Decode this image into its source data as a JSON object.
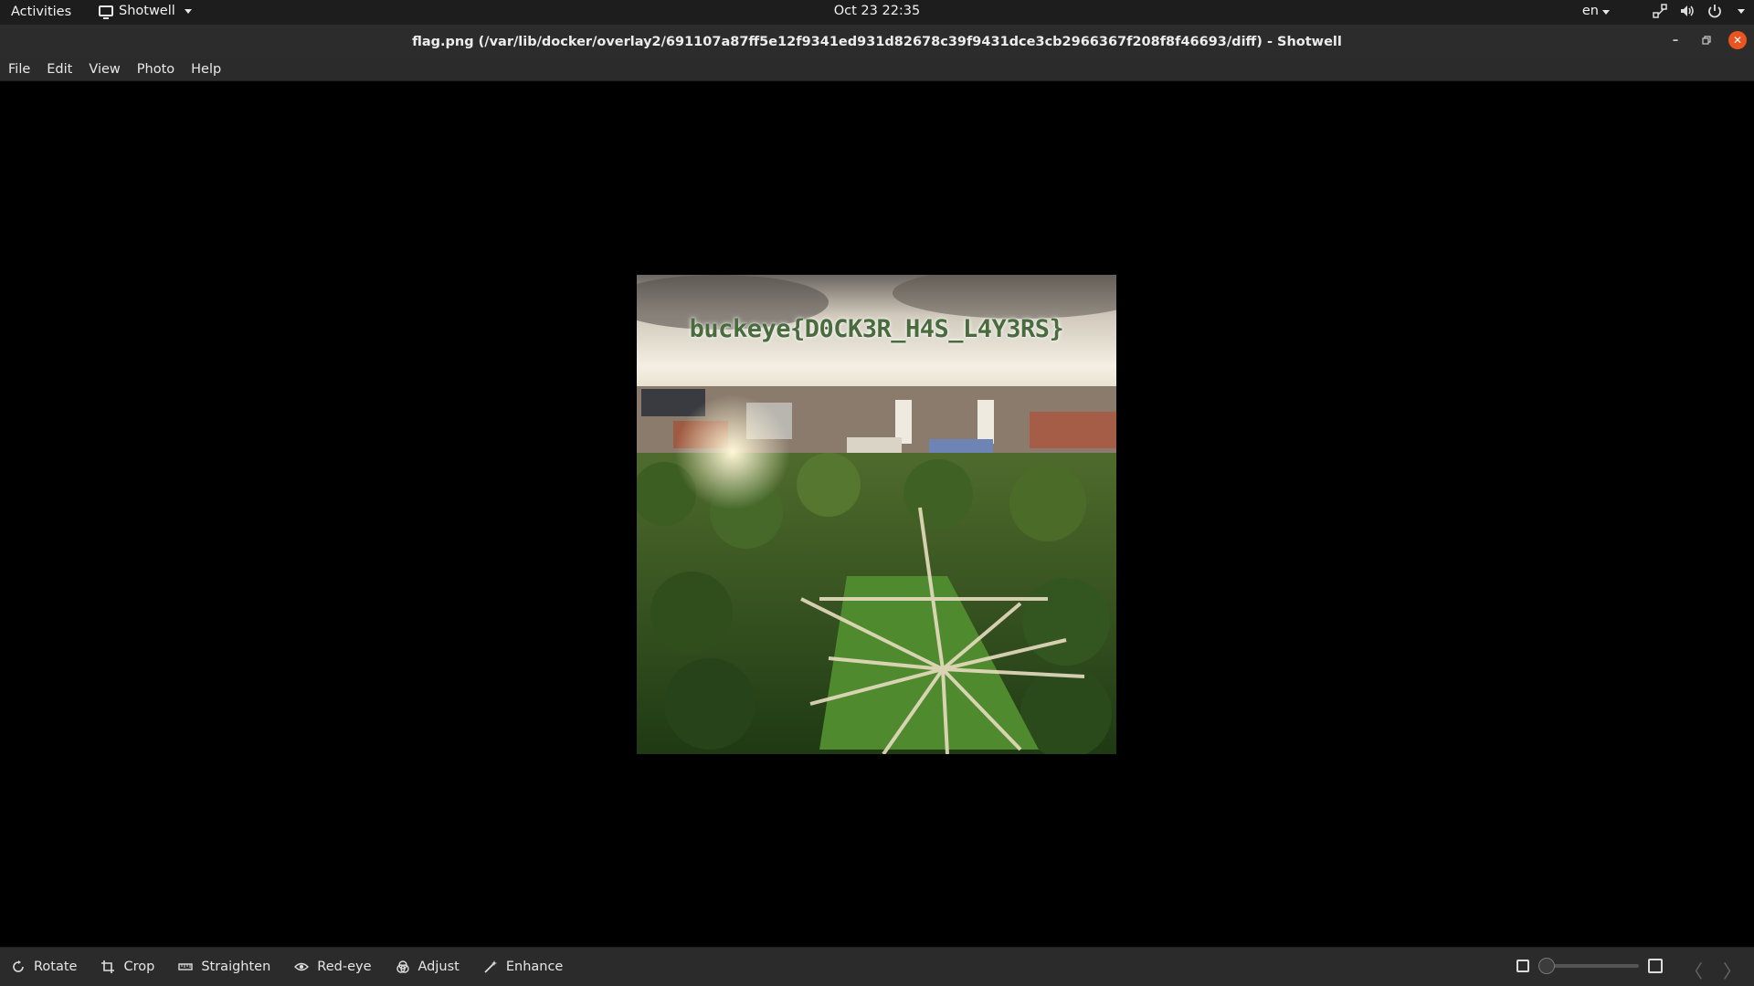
{
  "topbar": {
    "activities": "Activities",
    "app_name": "Shotwell",
    "clock": "Oct 23  22:35",
    "lang": "en"
  },
  "window": {
    "title": "flag.png (/var/lib/docker/overlay2/691107a87ff5e12f9341ed931d82678c39f9431dce3cb2966367f208f8f46693/diff) - Shotwell"
  },
  "menu": {
    "items": [
      "File",
      "Edit",
      "View",
      "Photo",
      "Help"
    ]
  },
  "photo": {
    "overlay_text": "buckeye{D0CK3R_H4S_L4Y3RS}"
  },
  "toolbar": {
    "rotate": "Rotate",
    "crop": "Crop",
    "straighten": "Straighten",
    "redeye": "Red-eye",
    "adjust": "Adjust",
    "enhance": "Enhance"
  },
  "zoom": {
    "level": 0
  },
  "colors": {
    "accent_close": "#e95420",
    "flag_text": "#4a6b3e"
  }
}
